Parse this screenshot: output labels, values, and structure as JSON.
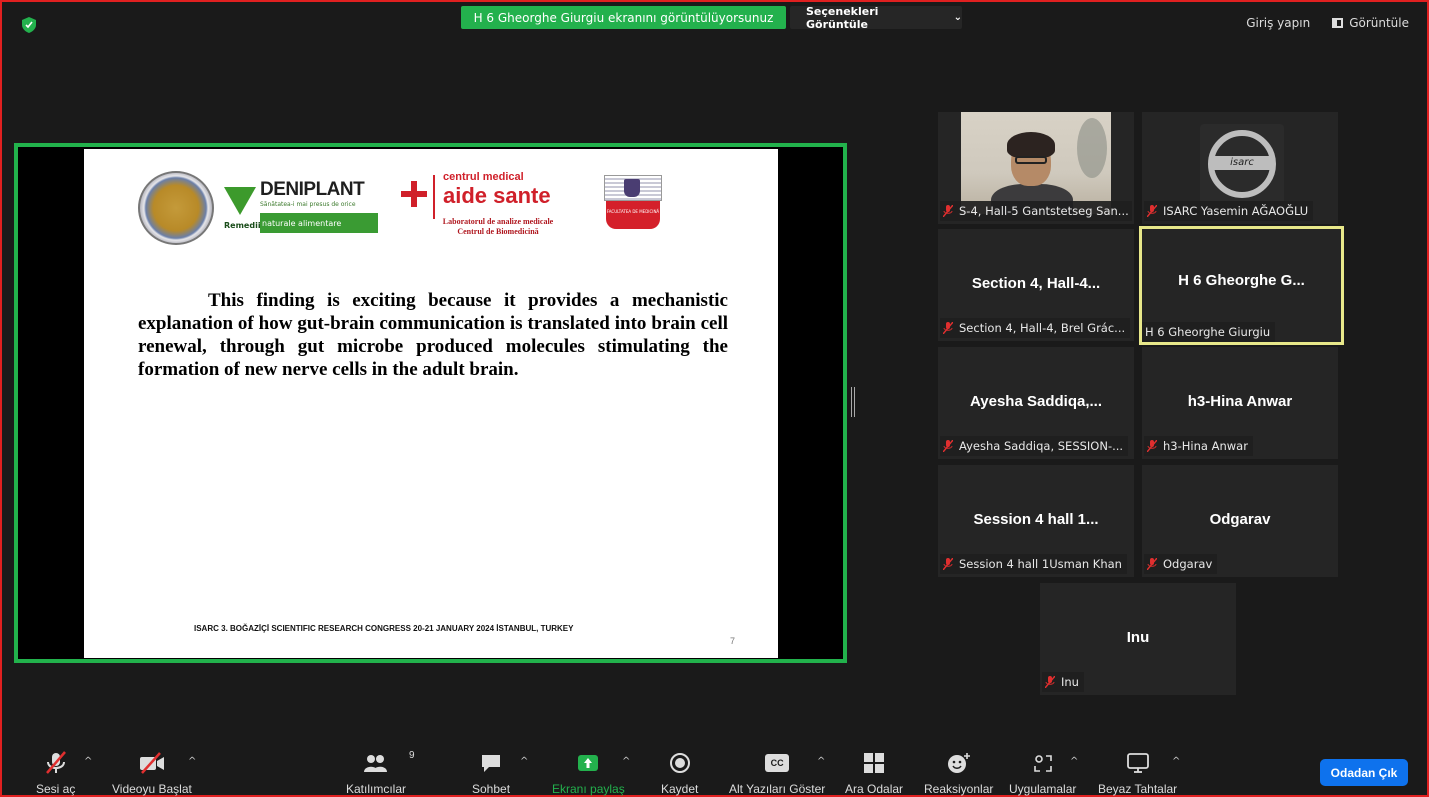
{
  "top_bar": {
    "share_banner": "H 6 Gheorghe Giurgiu ekranını görüntülüyorsunuz",
    "view_options": "Seçenekleri Görüntüle",
    "sign_in": "Giriş yapın",
    "view": "Görüntüle"
  },
  "slide": {
    "deniplant_name": "DENIPLANT",
    "deniplant_small": "Sănătatea-i mai presus de orice",
    "deniplant_remedii": "Remedii",
    "deniplant_naturale": "naturale alimentare",
    "aide_centrul": "centrul medical",
    "aide_name": "aide sante",
    "aide_lab1": "Laboratorul de analize medicale",
    "aide_lab2": "Centrul de Biomedicină",
    "faculty_text": "FACULTATEA DE MEDICINĂ",
    "body": "This finding is exciting because it provides a mechanistic explanation of how gut-brain communication is translated into brain cell renewal, through gut microbe produced molecules stimulating the formation of new nerve cells in the adult brain.",
    "footer": "ISARC 3. BOĞAZİÇİ SCIENTIFIC RESEARCH CONGRESS 20-21 JANUARY 2024 İSTANBUL, TURKEY",
    "page_number": "7"
  },
  "participants": [
    {
      "tile_name": "",
      "label": "S-4, Hall-5 Gantstetseg San...",
      "muted": true
    },
    {
      "tile_name": "",
      "label": "ISARC Yasemin AĞAOĞLU",
      "muted": true,
      "logo_text": "isarc"
    },
    {
      "tile_name": "Section 4, Hall-4...",
      "label": "Section 4, Hall-4, Brel Grác...",
      "muted": true
    },
    {
      "tile_name": "H 6 Gheorghe G...",
      "label": "H 6 Gheorghe Giurgiu",
      "muted": false
    },
    {
      "tile_name": "Ayesha Saddiqa,...",
      "label": "Ayesha Saddiqa, SESSION-...",
      "muted": true
    },
    {
      "tile_name": "h3-Hina Anwar",
      "label": "h3-Hina Anwar",
      "muted": true
    },
    {
      "tile_name": "Session 4 hall 1...",
      "label": "Session 4 hall 1Usman Khan",
      "muted": true
    },
    {
      "tile_name": "Odgarav",
      "label": "Odgarav",
      "muted": true
    },
    {
      "tile_name": "Inu",
      "label": "Inu",
      "muted": true
    }
  ],
  "toolbar": {
    "unmute": "Sesi aç",
    "start_video": "Videoyu Başlat",
    "participants": "Katılımcılar",
    "participants_count": "9",
    "chat": "Sohbet",
    "share_screen": "Ekranı paylaş",
    "record": "Kaydet",
    "captions": "Alt Yazıları Göster",
    "cc_icon_text": "CC",
    "breakout": "Ara Odalar",
    "reactions": "Reaksiyonlar",
    "apps": "Uygulamalar",
    "whiteboards": "Beyaz Tahtalar",
    "leave": "Odadan Çık"
  },
  "colors": {
    "share_green": "#23b14d",
    "share_border": "#22b24c",
    "active_speaker": "#e8e88a",
    "leave_blue": "#0e72ed",
    "muted_red": "#e02f2f",
    "window_border": "#e02020"
  }
}
